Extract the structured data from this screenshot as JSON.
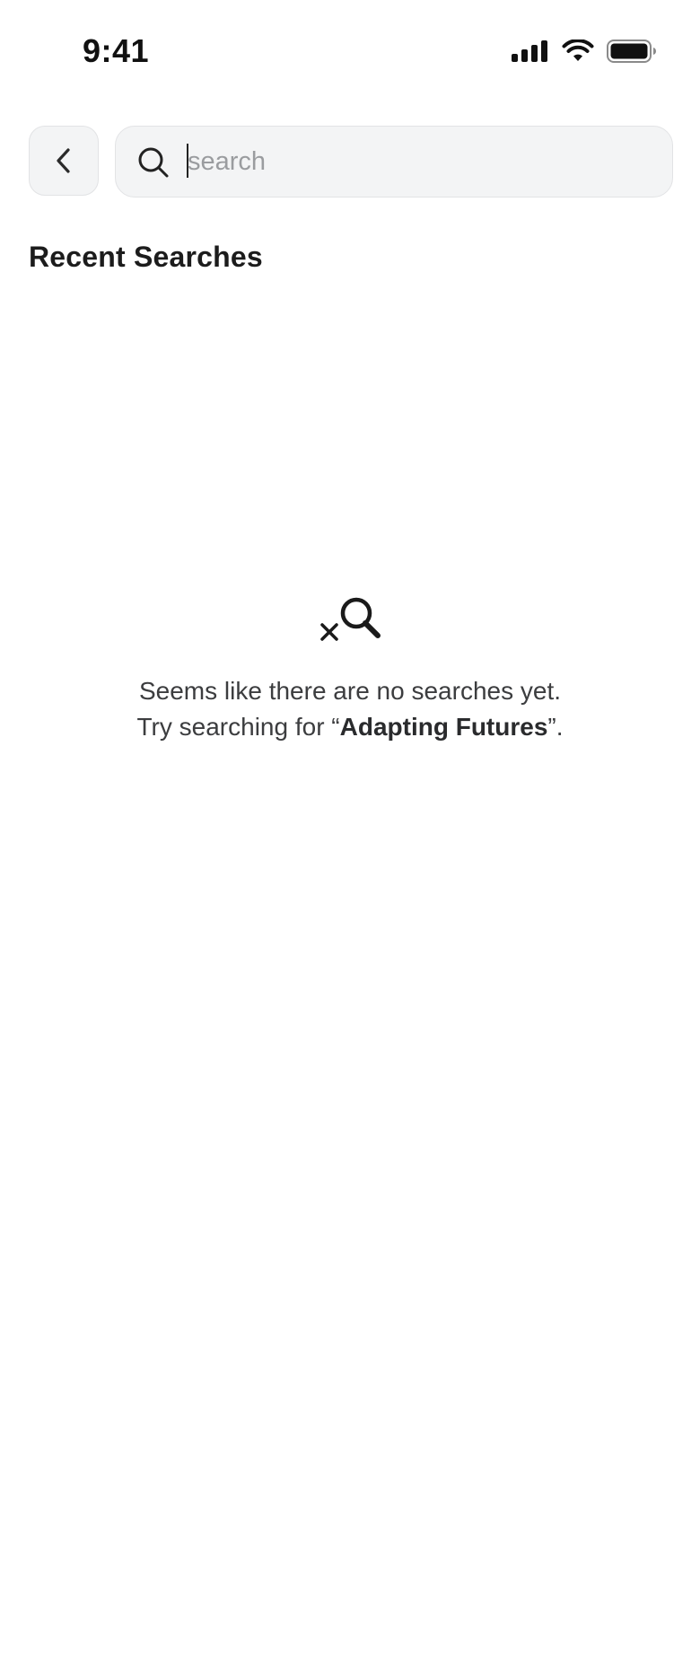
{
  "status_bar": {
    "time": "9:41",
    "icons": [
      "signal-icon",
      "wifi-icon",
      "battery-icon"
    ]
  },
  "header": {
    "back_icon": "chevron-left-icon",
    "search": {
      "icon": "search-icon",
      "placeholder": "search",
      "value": ""
    }
  },
  "recent": {
    "title": "Recent Searches",
    "items": []
  },
  "empty_state": {
    "icon": "search-off-icon",
    "line1": "Seems like there are no searches yet.",
    "line2_prefix": "Try searching for “",
    "line2_highlight": "Adapting Futures",
    "line2_suffix": "”."
  },
  "colors": {
    "background": "#ffffff",
    "field_bg": "#f3f4f5",
    "field_border": "#e2e3e5",
    "text_primary": "#1c1c1c",
    "text_secondary": "#3c3d3f",
    "placeholder": "#9a9c9f"
  }
}
